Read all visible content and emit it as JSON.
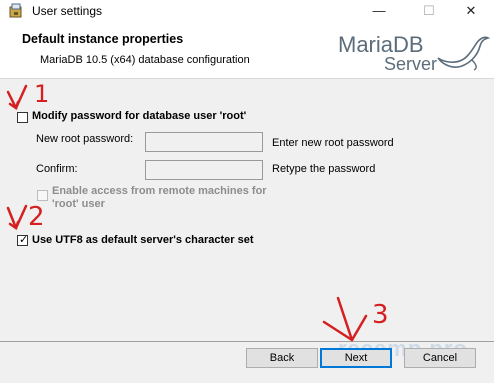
{
  "window": {
    "title": "User settings",
    "minimize": "—",
    "maximize": "☐",
    "close": "✕"
  },
  "header": {
    "title": "Default instance properties",
    "subtitle": "MariaDB 10.5 (x64) database configuration",
    "logo_main": "MariaDB",
    "logo_sub": "Server"
  },
  "options": {
    "modify_password": {
      "label": "Modify password for database user 'root'",
      "checked": false
    },
    "new_root_password": {
      "label": "New root password:",
      "value": "",
      "hint": "Enter new root password"
    },
    "confirm": {
      "label": "Confirm:",
      "value": "",
      "hint": "Retype the password"
    },
    "remote_access": {
      "label_line1": "Enable access from remote machines for",
      "label_line2": "'root' user",
      "checked": false,
      "enabled": false
    },
    "utf8": {
      "label": "Use UTF8 as default server's character set",
      "checked": true,
      "mark": "✓"
    }
  },
  "buttons": {
    "back": "Back",
    "next": "Next",
    "cancel": "Cancel"
  },
  "annotations": [
    "1",
    "2",
    "3"
  ],
  "watermark": "recemp.pro",
  "colors": {
    "annotation": "#d42020",
    "focus_border": "#0078d7",
    "logo": "#5b6d7c"
  }
}
